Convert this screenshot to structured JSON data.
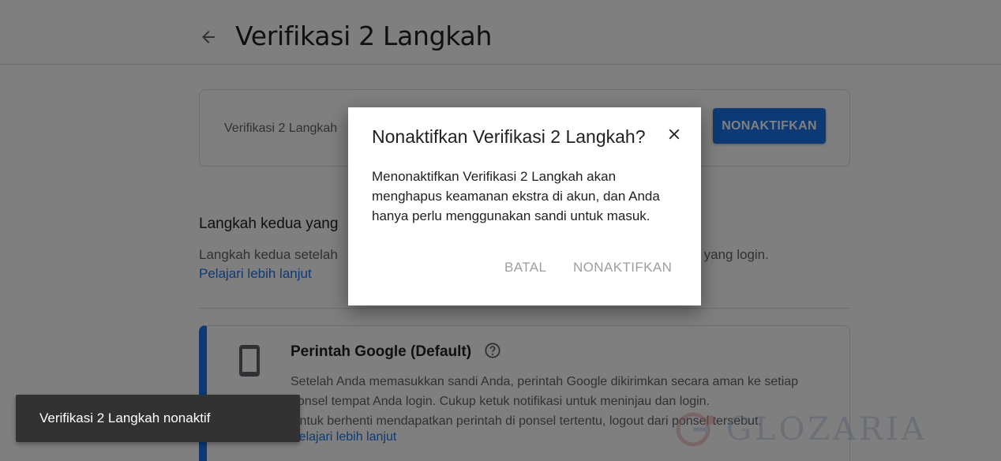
{
  "header": {
    "title": "Verifikasi 2 Langkah",
    "back_icon": "arrow-back-icon"
  },
  "status_card": {
    "text": "Verifikasi 2 Langkah",
    "button_label": "NONAKTIFKAN"
  },
  "second_step": {
    "heading": "Langkah kedua yang",
    "description": "Langkah kedua setelah",
    "description_end": "da yang login.",
    "learn_more": "Pelajari lebih lanjut"
  },
  "method": {
    "icon": "phone-icon",
    "title": "Perintah Google (Default)",
    "help_icon": "help-icon",
    "desc_1": "Setelah Anda memasukkan sandi Anda, perintah Google dikirimkan secara aman ke setiap",
    "desc_2": "ponsel tempat Anda login. Cukup ketuk notifikasi untuk meninjau dan login.",
    "desc_3": "Untuk berhenti mendapatkan perintah di ponsel tertentu, logout dari ponsel tersebut.",
    "learn_more": "Pelajari lebih lanjut"
  },
  "dialog": {
    "title": "Nonaktifkan Verifikasi 2 Langkah?",
    "close_icon": "close-icon",
    "body": "Menonaktifkan Verifikasi 2 Langkah akan menghapus keamanan ekstra di akun, dan Anda hanya perlu menggunakan sandi untuk masuk.",
    "cancel_label": "BATAL",
    "confirm_label": "NONAKTIFKAN"
  },
  "snackbar": {
    "text": "Verifikasi 2 Langkah nonaktif"
  },
  "watermark": {
    "text": "GLOZARIA"
  },
  "colors": {
    "accent": "#1a73e8",
    "scrim": "#808080",
    "snackbar": "#323232"
  }
}
